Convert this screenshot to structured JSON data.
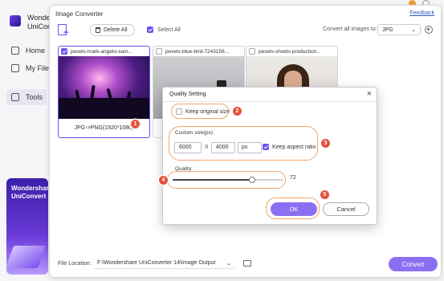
{
  "background_app": {
    "app_name_line1": "Wonders",
    "app_name_line2": "UniCon",
    "nav": [
      {
        "label": "Home"
      },
      {
        "label": "My File"
      },
      {
        "label": "Tools"
      }
    ],
    "promo_line1": "Wondershare",
    "promo_line2": "UniConvert"
  },
  "converter": {
    "title": "Image Converter",
    "feedback_link": "Feedback",
    "toolbar": {
      "delete_all": "Delete All",
      "select_all": "Select All",
      "convert_all_label": "Convert all images to:",
      "format": "JPG"
    },
    "thumbnails": [
      {
        "name": "pexels-mark-angelo-sam...",
        "checked": true,
        "footer": "JPG->PNG(1920*1080)"
      },
      {
        "name": "pexels-blue-bird-7243156...",
        "checked": false,
        "footer": ""
      },
      {
        "name": "pexels-shvets-production...",
        "checked": false,
        "footer": ""
      }
    ],
    "file_location_label": "File Location:",
    "file_location_path": "F:\\Wondershare UniConverter 14\\Image Output",
    "convert_button": "Convert"
  },
  "dialog": {
    "title": "Quality Setting",
    "keep_original_size": "Keep original size",
    "custom_size_label": "Custom size(px):",
    "width": "6000",
    "times": "X",
    "height": "4000",
    "unit": "px",
    "keep_aspect_ratio": "Keep aspect ratio",
    "keep_aspect_checked": true,
    "quality_label": "Quality:",
    "quality_value": "72",
    "quality_fraction": 0.72,
    "ok": "OK",
    "cancel": "Cancel"
  },
  "callouts": [
    "1",
    "2",
    "3",
    "4",
    "5"
  ],
  "icons": [
    "add-file-icon",
    "trash-icon",
    "gear-icon",
    "folder-icon",
    "close-icon",
    "chevron-down-icon"
  ],
  "colors": {
    "accent": "#8b6ff2",
    "callout": "#e8513b",
    "ring": "#f0a56a"
  }
}
